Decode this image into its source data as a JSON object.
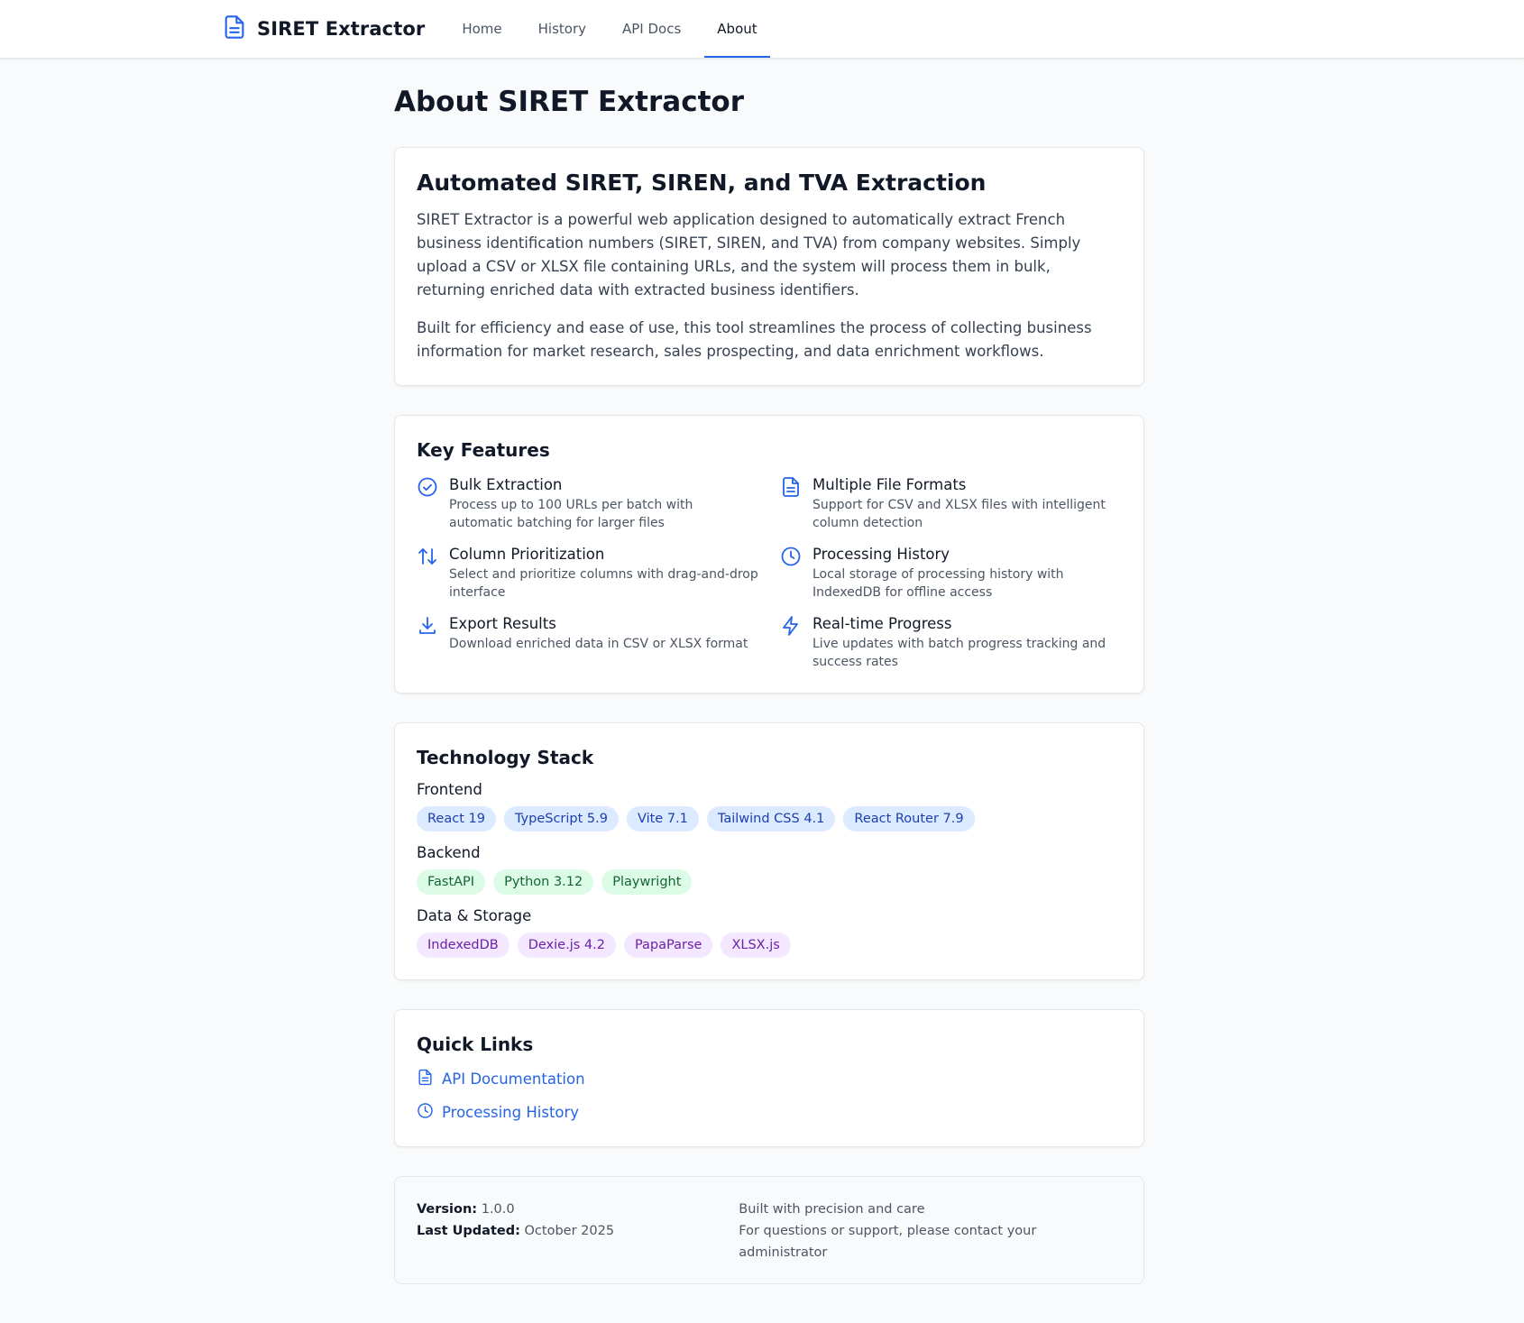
{
  "app": {
    "title": "SIRET Extractor",
    "logo_icon": "document-icon"
  },
  "nav": {
    "items": [
      {
        "label": "Home",
        "active": false
      },
      {
        "label": "History",
        "active": false
      },
      {
        "label": "API Docs",
        "active": false
      },
      {
        "label": "About",
        "active": true
      }
    ]
  },
  "page": {
    "title": "About SIRET Extractor"
  },
  "intro": {
    "heading": "Automated SIRET, SIREN, and TVA Extraction",
    "paragraph1": "SIRET Extractor is a powerful web application designed to automatically extract French business identification numbers (SIRET, SIREN, and TVA) from company websites. Simply upload a CSV or XLSX file containing URLs, and the system will process them in bulk, returning enriched data with extracted business identifiers.",
    "paragraph2": "Built for efficiency and ease of use, this tool streamlines the process of collecting business information for market research, sales prospecting, and data enrichment workflows."
  },
  "features": {
    "heading": "Key Features",
    "items": [
      {
        "icon": "check-circle-icon",
        "title": "Bulk Extraction",
        "description": "Process up to 100 URLs per batch with automatic batching for larger files"
      },
      {
        "icon": "document-icon",
        "title": "Multiple File Formats",
        "description": "Support for CSV and XLSX files with intelligent column detection"
      },
      {
        "icon": "arrows-up-down-icon",
        "title": "Column Prioritization",
        "description": "Select and prioritize columns with drag-and-drop interface"
      },
      {
        "icon": "clock-icon",
        "title": "Processing History",
        "description": "Local storage of processing history with IndexedDB for offline access"
      },
      {
        "icon": "download-icon",
        "title": "Export Results",
        "description": "Download enriched data in CSV or XLSX format"
      },
      {
        "icon": "lightning-icon",
        "title": "Real-time Progress",
        "description": "Live updates with batch progress tracking and success rates"
      }
    ]
  },
  "tech": {
    "heading": "Technology Stack",
    "groups": [
      {
        "label": "Frontend",
        "color": "blue",
        "tags": [
          "React 19",
          "TypeScript 5.9",
          "Vite 7.1",
          "Tailwind CSS 4.1",
          "React Router 7.9"
        ]
      },
      {
        "label": "Backend",
        "color": "green",
        "tags": [
          "FastAPI",
          "Python 3.12",
          "Playwright"
        ]
      },
      {
        "label": "Data & Storage",
        "color": "purple",
        "tags": [
          "IndexedDB",
          "Dexie.js 4.2",
          "PapaParse",
          "XLSX.js"
        ]
      }
    ]
  },
  "quick_links": {
    "heading": "Quick Links",
    "items": [
      {
        "icon": "document-icon",
        "label": "API Documentation"
      },
      {
        "icon": "clock-icon",
        "label": "Processing History"
      }
    ]
  },
  "footer": {
    "version_label": "Version:",
    "version_value": "1.0.0",
    "updated_label": "Last Updated:",
    "updated_value": "October 2025",
    "tagline": "Built with precision and care",
    "support": "For questions or support, please contact your administrator"
  },
  "colors": {
    "accent": "#2563eb",
    "background": "#f9fafb",
    "card": "#ffffff"
  }
}
